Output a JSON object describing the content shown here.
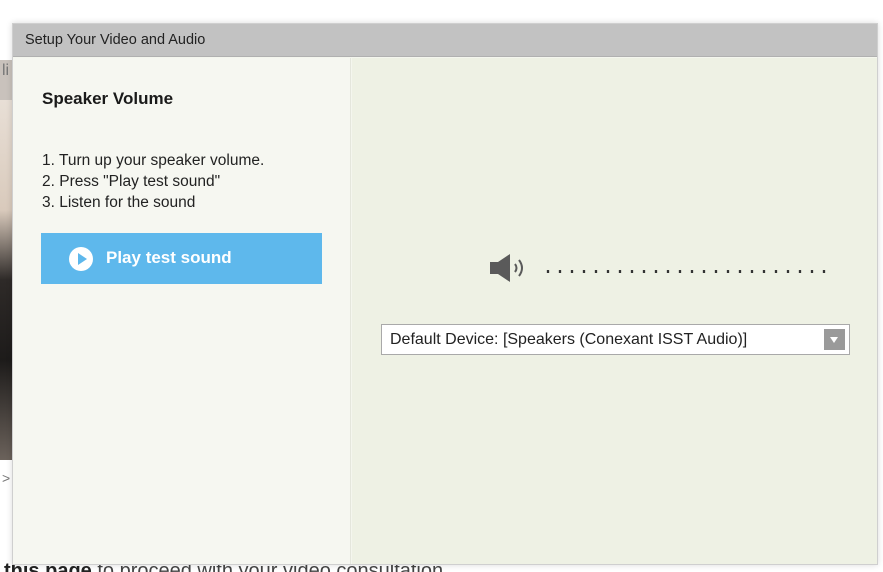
{
  "dialog": {
    "title": "Setup Your Video and Audio"
  },
  "speaker_section": {
    "heading": "Speaker Volume",
    "steps": [
      "1. Turn up your speaker volume.",
      "2. Press \"Play test sound\"",
      "3. Listen for the sound"
    ],
    "play_button_label": "Play test sound",
    "level_indicator": "........................",
    "device_select_value": "Default Device: [Speakers (Conexant ISST Audio)]"
  },
  "background": {
    "left_fragment": "li",
    "left_fragment_2": ">",
    "bottom_text_bold": "this page",
    "bottom_text_rest": " to proceed with your video consultation"
  },
  "colors": {
    "play_button": "#5eb8ec",
    "titlebar": "#c2c2c2",
    "right_pane": "#eef1e4"
  },
  "icons": [
    "play-icon",
    "speaker-icon",
    "dropdown-arrow-icon"
  ]
}
